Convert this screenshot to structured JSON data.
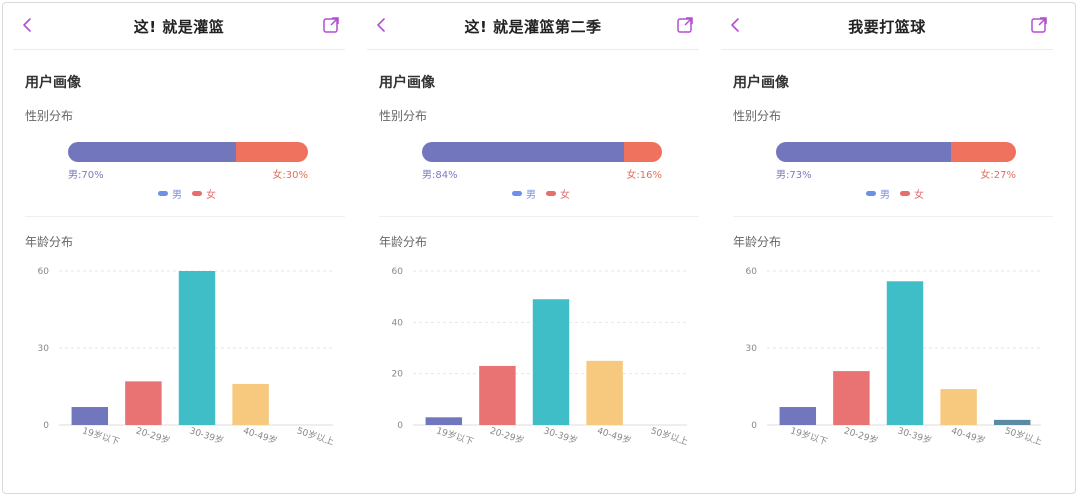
{
  "colors": {
    "male": "#7176bd",
    "female": "#ee725e",
    "bars": [
      "#7176bd",
      "#e97272",
      "#3fbec8",
      "#f6c97f",
      "#5b8aa4"
    ],
    "accent": "#b34fd3"
  },
  "panels": [
    {
      "title": "这! 就是灌篮",
      "section": "用户画像",
      "gender_title": "性别分布",
      "male_label": "男:70%",
      "female_label": "女:30%",
      "legend_male": "男",
      "legend_female": "女",
      "age_title": "年龄分布"
    },
    {
      "title": "这! 就是灌篮第二季",
      "section": "用户画像",
      "gender_title": "性别分布",
      "male_label": "男:84%",
      "female_label": "女:16%",
      "legend_male": "男",
      "legend_female": "女",
      "age_title": "年龄分布"
    },
    {
      "title": "我要打篮球",
      "section": "用户画像",
      "gender_title": "性别分布",
      "male_label": "男:73%",
      "female_label": "女:27%",
      "legend_male": "男",
      "legend_female": "女",
      "age_title": "年龄分布"
    }
  ],
  "chart_data": [
    {
      "type": "bar",
      "title": "这! 就是灌篮 — 性别分布",
      "categories": [
        "男",
        "女"
      ],
      "values": [
        70,
        30
      ],
      "unit": "%"
    },
    {
      "type": "bar",
      "title": "这! 就是灌篮 — 年龄分布",
      "categories": [
        "19岁以下",
        "20-29岁",
        "30-39岁",
        "40-49岁",
        "50岁以上"
      ],
      "values": [
        7,
        17,
        60,
        16,
        0
      ],
      "ylim": [
        0,
        60
      ],
      "yticks": [
        0,
        30,
        60
      ]
    },
    {
      "type": "bar",
      "title": "这! 就是灌篮第二季 — 性别分布",
      "categories": [
        "男",
        "女"
      ],
      "values": [
        84,
        16
      ],
      "unit": "%"
    },
    {
      "type": "bar",
      "title": "这! 就是灌篮第二季 — 年龄分布",
      "categories": [
        "19岁以下",
        "20-29岁",
        "30-39岁",
        "40-49岁",
        "50岁以上"
      ],
      "values": [
        3,
        23,
        49,
        25,
        0
      ],
      "ylim": [
        0,
        60
      ],
      "yticks": [
        0,
        20,
        40,
        60
      ]
    },
    {
      "type": "bar",
      "title": "我要打篮球 — 性别分布",
      "categories": [
        "男",
        "女"
      ],
      "values": [
        73,
        27
      ],
      "unit": "%"
    },
    {
      "type": "bar",
      "title": "我要打篮球 — 年龄分布",
      "categories": [
        "19岁以下",
        "20-29岁",
        "30-39岁",
        "40-49岁",
        "50岁以上"
      ],
      "values": [
        7,
        21,
        56,
        14,
        2
      ],
      "ylim": [
        0,
        60
      ],
      "yticks": [
        0,
        30,
        60
      ]
    }
  ]
}
